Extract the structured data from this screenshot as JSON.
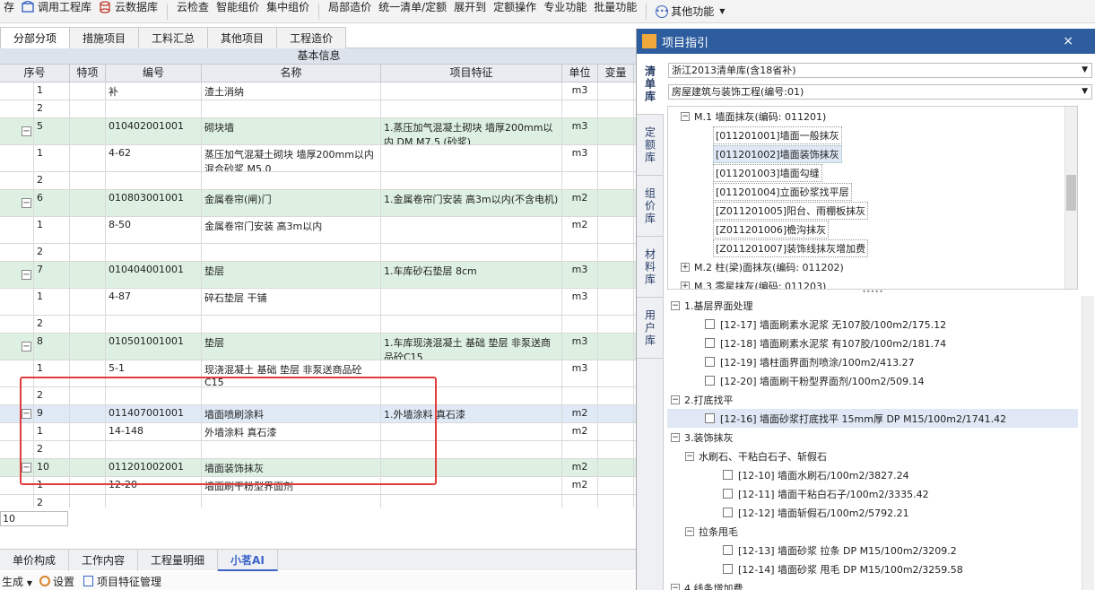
{
  "toolbar": {
    "lead": "存",
    "items": [
      "调用工程库",
      "云数据库",
      "云检查",
      "智能组价",
      "集中组价",
      "局部造价",
      "统一清单/定额",
      "展开到",
      "定额操作",
      "专业功能",
      "批量功能"
    ],
    "more": "其他功能"
  },
  "tabs": [
    "分部分项",
    "措施项目",
    "工料汇总",
    "其他项目",
    "工程造价"
  ],
  "grid": {
    "group_header": "基本信息",
    "columns": [
      "序号",
      "特项",
      "编号",
      "名称",
      "项目特征",
      "单位",
      "变量"
    ],
    "rows": [
      {
        "seq": "1",
        "code": "补",
        "name": "渣土消纳",
        "feature": "",
        "unit": "m3",
        "type": "sub",
        "tag": ""
      },
      {
        "seq": "2",
        "code": "",
        "name": "",
        "feature": "",
        "unit": "",
        "type": "sub",
        "tag": ""
      },
      {
        "seq": "5",
        "code": "010402001001",
        "name": "砌块墙",
        "feature": "1.蒸压加气混凝土砌块 墙厚200mm以内 DM M7.5 (砂浆)",
        "unit": "m3",
        "type": "main",
        "tag": ""
      },
      {
        "seq": "1",
        "code": "4-62",
        "name": "蒸压加气混凝土砌块 墙厚200mm以内 混合砂浆 M5.0",
        "feature": "",
        "unit": "m3",
        "type": "sub",
        "tag": "换"
      },
      {
        "seq": "2",
        "code": "",
        "name": "",
        "feature": "",
        "unit": "",
        "type": "sub",
        "tag": ""
      },
      {
        "seq": "6",
        "code": "010803001001",
        "name": "金属卷帘(闸)门",
        "feature": "1.金属卷帘门安装 高3m以内(不含电机)",
        "unit": "m2",
        "type": "main",
        "tag": ""
      },
      {
        "seq": "1",
        "code": "8-50",
        "name": "金属卷帘门安装 高3m以内",
        "feature": "",
        "unit": "m2",
        "type": "sub",
        "tag": "换"
      },
      {
        "seq": "2",
        "code": "",
        "name": "",
        "feature": "",
        "unit": "",
        "type": "sub",
        "tag": ""
      },
      {
        "seq": "7",
        "code": "010404001001",
        "name": "垫层",
        "feature": "1.车库砂石垫层 8cm",
        "unit": "m3",
        "type": "main",
        "tag": ""
      },
      {
        "seq": "1",
        "code": "4-87",
        "name": "碎石垫层 干铺",
        "feature": "",
        "unit": "m3",
        "type": "sub",
        "tag": "换"
      },
      {
        "seq": "2",
        "code": "",
        "name": "",
        "feature": "",
        "unit": "",
        "type": "sub",
        "tag": ""
      },
      {
        "seq": "8",
        "code": "010501001001",
        "name": "垫层",
        "feature": "1.车库现浇混凝土 基础 垫层 非泵送商品砼C15",
        "unit": "m3",
        "type": "main",
        "tag": ""
      },
      {
        "seq": "1",
        "code": "5-1",
        "name": "现浇混凝土 基础 垫层 非泵送商品砼C15",
        "feature": "",
        "unit": "m3",
        "type": "sub",
        "tag": "换关"
      },
      {
        "seq": "2",
        "code": "",
        "name": "",
        "feature": "",
        "unit": "",
        "type": "sub",
        "tag": ""
      },
      {
        "seq": "9",
        "code": "011407001001",
        "name": "墙面喷刷涂料",
        "feature": "1.外墙涂料 真石漆",
        "unit": "m2",
        "type": "sel",
        "tag": ""
      },
      {
        "seq": "1",
        "code": "14-148",
        "name": "外墙涂料 真石漆",
        "feature": "",
        "unit": "m2",
        "type": "sub",
        "tag": ""
      },
      {
        "seq": "2",
        "code": "",
        "name": "",
        "feature": "",
        "unit": "",
        "type": "sub",
        "tag": ""
      },
      {
        "seq": "10",
        "code": "011201002001",
        "name": "墙面装饰抹灰",
        "feature": "",
        "unit": "m2",
        "type": "main",
        "tag": ""
      },
      {
        "seq": "1",
        "code": "12-20",
        "name": "墙面刷干粉型界面剂",
        "feature": "",
        "unit": "m2",
        "type": "sub",
        "tag": "换"
      },
      {
        "seq": "2",
        "code": "",
        "name": "",
        "feature": "",
        "unit": "",
        "type": "sub",
        "tag": ""
      }
    ]
  },
  "input_value": "10",
  "bottom_tabs": [
    "单价构成",
    "工作内容",
    "工程量明细",
    "小茗AI"
  ],
  "bottom_bar": [
    "生成",
    "设置",
    "项目特征管理"
  ],
  "panel": {
    "title": "项目指引",
    "close": "×",
    "vtabs": [
      "清单库",
      "定额库",
      "组价库",
      "材料库",
      "用户库"
    ],
    "sel1": "浙江2013清单库(含18省补)",
    "sel2": "房屋建筑与装饰工程(编号:01)",
    "tree": [
      {
        "text": "M.1 墙面抹灰(编码: 011201)",
        "level": 0,
        "box": "−",
        "hl": false
      },
      {
        "text": "[011201001]墙面一般抹灰",
        "level": 1,
        "box": "",
        "hl": false
      },
      {
        "text": "[011201002]墙面装饰抹灰",
        "level": 1,
        "box": "",
        "hl": true
      },
      {
        "text": "[011201003]墙面勾缝",
        "level": 1,
        "box": "",
        "hl": false
      },
      {
        "text": "[011201004]立面砂浆找平层",
        "level": 1,
        "box": "",
        "hl": false
      },
      {
        "text": "[Z011201005]阳台、雨棚板抹灰",
        "level": 1,
        "box": "",
        "hl": false
      },
      {
        "text": "[Z011201006]檐沟抹灰",
        "level": 1,
        "box": "",
        "hl": false
      },
      {
        "text": "[Z011201007]装饰线抹灰增加费",
        "level": 1,
        "box": "",
        "hl": false
      },
      {
        "text": "M.2 柱(梁)面抹灰(编码: 011202)",
        "level": 0,
        "box": "+",
        "hl": false
      },
      {
        "text": "M.3 零星抹灰(编码: 011203)",
        "level": 0,
        "box": "+",
        "hl": false
      }
    ],
    "splitter": "•••••",
    "tree2": [
      {
        "text": "1.基层界面处理",
        "level": 0,
        "kind": "group",
        "hl": false
      },
      {
        "text": "[12-17] 墙面刷素水泥浆 无107胶/100m2/175.12",
        "level": 1,
        "kind": "item",
        "hl": false
      },
      {
        "text": "[12-18] 墙面刷素水泥浆 有107胶/100m2/181.74",
        "level": 1,
        "kind": "item",
        "hl": false
      },
      {
        "text": "[12-19] 墙柱面界面剂喷涂/100m2/413.27",
        "level": 1,
        "kind": "item",
        "hl": false
      },
      {
        "text": "[12-20] 墙面刷干粉型界面剂/100m2/509.14",
        "level": 1,
        "kind": "item",
        "hl": false
      },
      {
        "text": "2.打底找平",
        "level": 0,
        "kind": "group",
        "hl": false
      },
      {
        "text": "[12-16] 墙面砂浆打底找平 15mm厚 DP M15/100m2/1741.42",
        "level": 1,
        "kind": "item",
        "hl": true
      },
      {
        "text": "3.装饰抹灰",
        "level": 0,
        "kind": "group",
        "hl": false
      },
      {
        "text": "水刷石、干粘白石子、斩假石",
        "level": 1,
        "kind": "group",
        "hl": false
      },
      {
        "text": "[12-10] 墙面水刷石/100m2/3827.24",
        "level": 2,
        "kind": "item",
        "hl": false
      },
      {
        "text": "[12-11] 墙面干粘白石子/100m2/3335.42",
        "level": 2,
        "kind": "item",
        "hl": false
      },
      {
        "text": "[12-12] 墙面斩假石/100m2/5792.21",
        "level": 2,
        "kind": "item",
        "hl": false
      },
      {
        "text": "拉条甩毛",
        "level": 1,
        "kind": "group",
        "hl": false
      },
      {
        "text": "[12-13] 墙面砂浆 拉条 DP M15/100m2/3209.2",
        "level": 2,
        "kind": "item",
        "hl": false
      },
      {
        "text": "[12-14] 墙面砂浆 甩毛 DP M15/100m2/3259.58",
        "level": 2,
        "kind": "item",
        "hl": false
      },
      {
        "text": "4.线条增加费",
        "level": 0,
        "kind": "group",
        "hl": false
      }
    ]
  },
  "colors": {
    "panel_title": "#2e5d9f",
    "main_row": "#ddf0e2",
    "selected_row": "#dfeaf6",
    "highlight": "#e23b3b"
  }
}
